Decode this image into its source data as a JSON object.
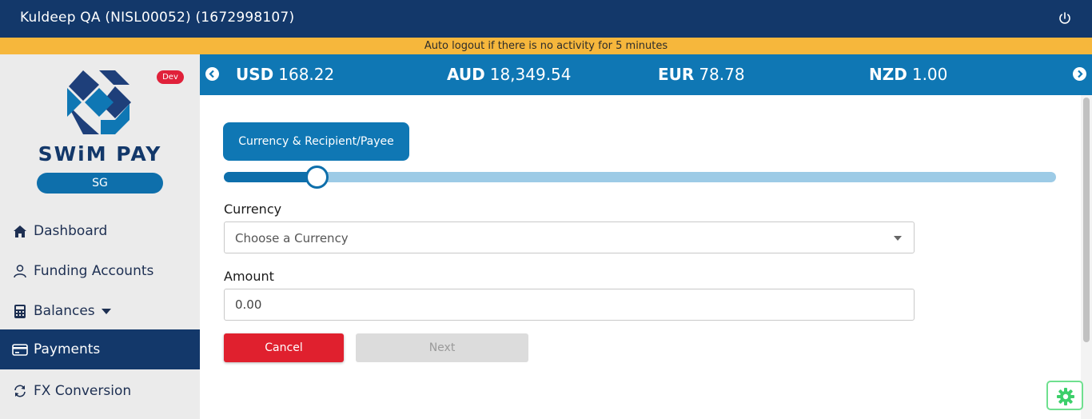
{
  "header": {
    "title": "Kuldeep QA (NISL00052) (1672998107)",
    "power_icon": "power-icon"
  },
  "notice": {
    "text": "Auto logout if there is no activity for 5 minutes"
  },
  "sidebar": {
    "badge": "Dev",
    "brand": "SWiM PAY",
    "region": "SG",
    "items": [
      {
        "label": "Dashboard",
        "icon": "home-icon"
      },
      {
        "label": "Funding Accounts",
        "icon": "user-icon"
      },
      {
        "label": "Balances",
        "icon": "calculator-icon"
      },
      {
        "label": "Payments",
        "icon": "card-icon"
      },
      {
        "label": "FX Conversion",
        "icon": "refresh-icon"
      }
    ]
  },
  "ticker": {
    "rates": [
      {
        "code": "USD",
        "value": "168.22"
      },
      {
        "code": "AUD",
        "value": "18,349.54"
      },
      {
        "code": "EUR",
        "value": "78.78"
      },
      {
        "code": "NZD",
        "value": "1.00"
      }
    ]
  },
  "stepper": {
    "current_step": "Currency & Recipient/Payee",
    "progress_fraction": 0.112
  },
  "form": {
    "currency_label": "Currency",
    "currency_placeholder": "Choose a Currency",
    "amount_label": "Amount",
    "amount_value": "0.00",
    "cancel_label": "Cancel",
    "next_label": "Next"
  },
  "colors": {
    "header": "#13386a",
    "accent": "#0f77b4",
    "notice": "#f6b73c",
    "danger": "#e0202e",
    "gear": "#6fe08f"
  }
}
